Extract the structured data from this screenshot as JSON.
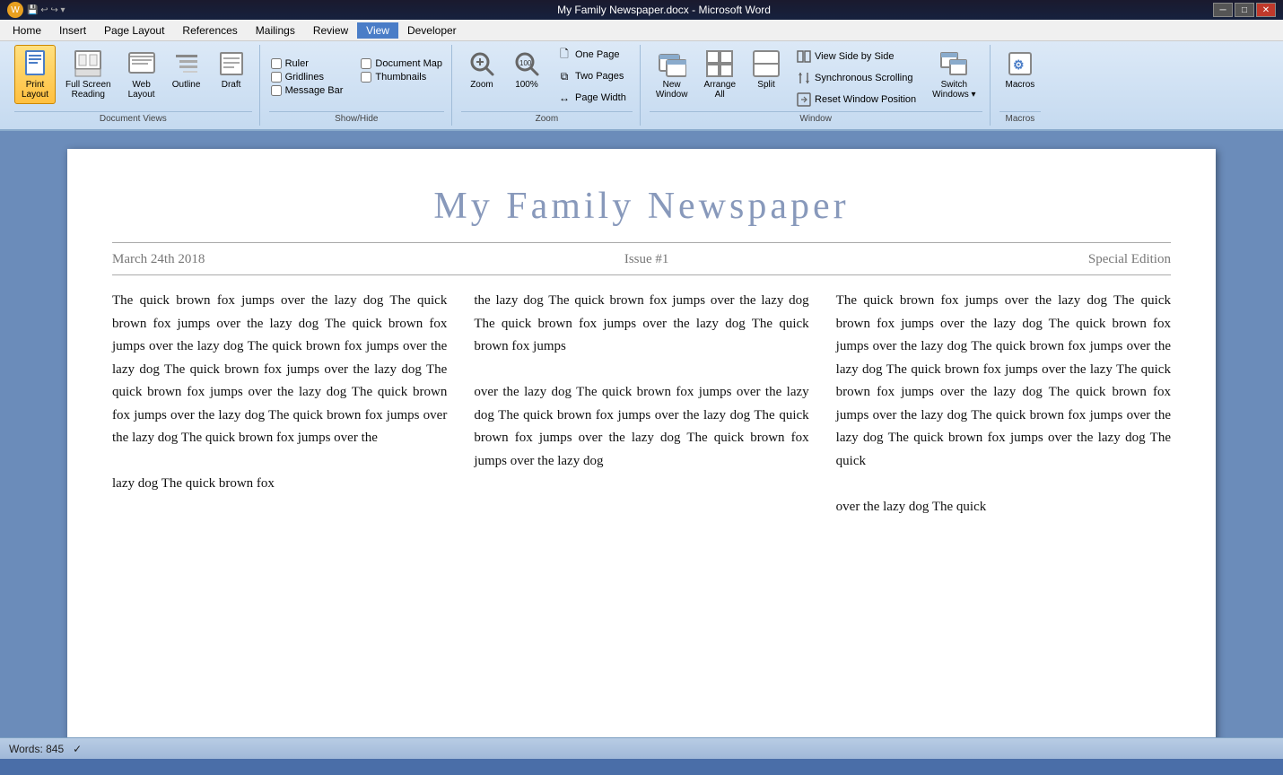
{
  "titlebar": {
    "title": "My Family Newspaper.docx - Microsoft Word",
    "btn_min": "─",
    "btn_max": "□",
    "btn_close": "✕"
  },
  "menubar": {
    "items": [
      "Home",
      "Insert",
      "Page Layout",
      "References",
      "Mailings",
      "Review",
      "View",
      "Developer"
    ],
    "active": "View"
  },
  "ribbon": {
    "groups": [
      {
        "label": "Document Views",
        "buttons": [
          {
            "id": "print-layout",
            "icon": "📄",
            "label": "Print\nLayout",
            "active": true
          },
          {
            "id": "full-screen-reading",
            "icon": "📖",
            "label": "Full Screen\nReading",
            "active": false
          },
          {
            "id": "web-layout",
            "icon": "🌐",
            "label": "Web\nLayout",
            "active": false
          },
          {
            "id": "outline",
            "icon": "☰",
            "label": "Outline",
            "active": false
          },
          {
            "id": "draft",
            "icon": "📝",
            "label": "Draft",
            "active": false
          }
        ]
      },
      {
        "label": "Show/Hide",
        "checkboxes": [
          {
            "id": "ruler",
            "label": "Ruler",
            "checked": false
          },
          {
            "id": "gridlines",
            "label": "Gridlines",
            "checked": false
          },
          {
            "id": "message-bar",
            "label": "Message Bar",
            "checked": false
          },
          {
            "id": "document-map",
            "label": "Document Map",
            "checked": false
          },
          {
            "id": "thumbnails",
            "label": "Thumbnails",
            "checked": false
          }
        ]
      },
      {
        "label": "Zoom",
        "buttons": [
          {
            "id": "zoom",
            "icon": "🔍",
            "label": "Zoom",
            "active": false
          },
          {
            "id": "zoom-100",
            "icon": "100%",
            "label": "100%",
            "active": false
          }
        ],
        "small_buttons": [
          {
            "id": "one-page",
            "icon": "🗋",
            "label": "One Page"
          },
          {
            "id": "two-pages",
            "icon": "🗋🗋",
            "label": "Two Pages"
          },
          {
            "id": "page-width",
            "icon": "↔",
            "label": "Page Width"
          }
        ]
      },
      {
        "label": "Window",
        "buttons": [
          {
            "id": "new-window",
            "icon": "🪟",
            "label": "New\nWindow",
            "active": false
          },
          {
            "id": "arrange-all",
            "icon": "⊞",
            "label": "Arrange\nAll",
            "active": false
          },
          {
            "id": "split",
            "icon": "⊟",
            "label": "Split",
            "active": false
          },
          {
            "id": "switch-windows",
            "icon": "⧉",
            "label": "Switch\nWindows▾",
            "active": false
          }
        ],
        "small_buttons": [
          {
            "id": "view-side-by-side",
            "icon": "⧉",
            "label": "View Side by Side"
          },
          {
            "id": "synchronous-scrolling",
            "icon": "↕",
            "label": "Synchronous Scrolling"
          },
          {
            "id": "reset-window-position",
            "icon": "⊡",
            "label": "Reset Window Position"
          }
        ]
      },
      {
        "label": "Macros",
        "buttons": [
          {
            "id": "macros",
            "icon": "⚙",
            "label": "Macros",
            "active": false
          }
        ]
      }
    ]
  },
  "document": {
    "title": "My Family Newspaper",
    "date": "March 24th 2018",
    "issue": "Issue #1",
    "edition": "Special Edition",
    "col1": "The quick brown fox jumps over the lazy dog The quick brown fox jumps over the lazy dog The quick brown fox jumps over the lazy dog The quick brown fox jumps over the lazy dog The quick brown fox jumps over the lazy dog The quick brown fox jumps over the lazy dog The quick brown fox jumps over the lazy dog The quick brown fox jumps over the lazy dog The quick brown fox jumps over the",
    "col1b": "lazy dog The quick brown fox",
    "col2": "the lazy dog The quick brown fox jumps over the lazy dog The quick brown fox jumps over the lazy dog The quick brown fox jumps",
    "col2b": "over the lazy dog The quick brown fox jumps over the lazy dog The quick brown fox jumps over the lazy dog The quick brown fox jumps over the lazy dog The quick brown fox jumps over the lazy dog",
    "col3": "The quick brown fox jumps over the lazy dog The quick brown fox jumps over the lazy dog The quick brown fox jumps over the lazy dog The quick brown fox jumps over the lazy dog The quick brown fox jumps over the lazy The quick brown fox jumps over the lazy dog The quick brown fox jumps over the lazy dog The quick brown fox jumps over the lazy dog The quick brown fox jumps over the lazy dog The quick",
    "col3b": "over the lazy dog The quick"
  },
  "statusbar": {
    "words": "Words: 845",
    "icon": "✓"
  }
}
